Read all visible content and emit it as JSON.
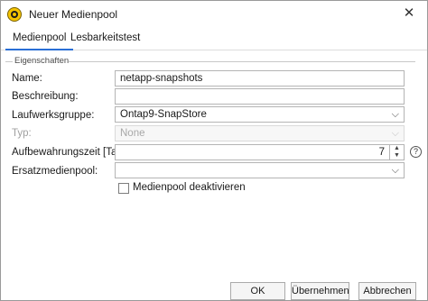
{
  "window": {
    "title": "Neuer Medienpool",
    "close_glyph": "✕",
    "icon": "app-logo-icon"
  },
  "tabs": [
    {
      "label": "Medienpool",
      "active": true
    },
    {
      "label": "Lesbarkeitstest",
      "active": false
    }
  ],
  "group": {
    "label": "Eigenschaften"
  },
  "fields": {
    "name": {
      "label": "Name:",
      "value": "netapp-snapshots"
    },
    "description": {
      "label": "Beschreibung:",
      "value": ""
    },
    "drive_group": {
      "label": "Laufwerksgruppe:",
      "value": "Ontap9-SnapStore"
    },
    "type": {
      "label": "Typ:",
      "value": "None",
      "disabled": true
    },
    "retention": {
      "label": "Aufbewahrungszeit [Tage]:",
      "value": "7",
      "help_glyph": "?"
    },
    "replacement": {
      "label": "Ersatzmedienpool:",
      "value": ""
    }
  },
  "checkbox": {
    "label": "Medienpool deaktivieren",
    "checked": false
  },
  "icons": {
    "chevron": "⌵",
    "spin_up": "▲",
    "spin_down": "▼"
  },
  "buttons": {
    "ok": "OK",
    "apply": "Übernehmen",
    "cancel": "Abbrechen"
  },
  "colors": {
    "tab_accent": "#2a6fd6",
    "app_icon": "#f4c300"
  }
}
